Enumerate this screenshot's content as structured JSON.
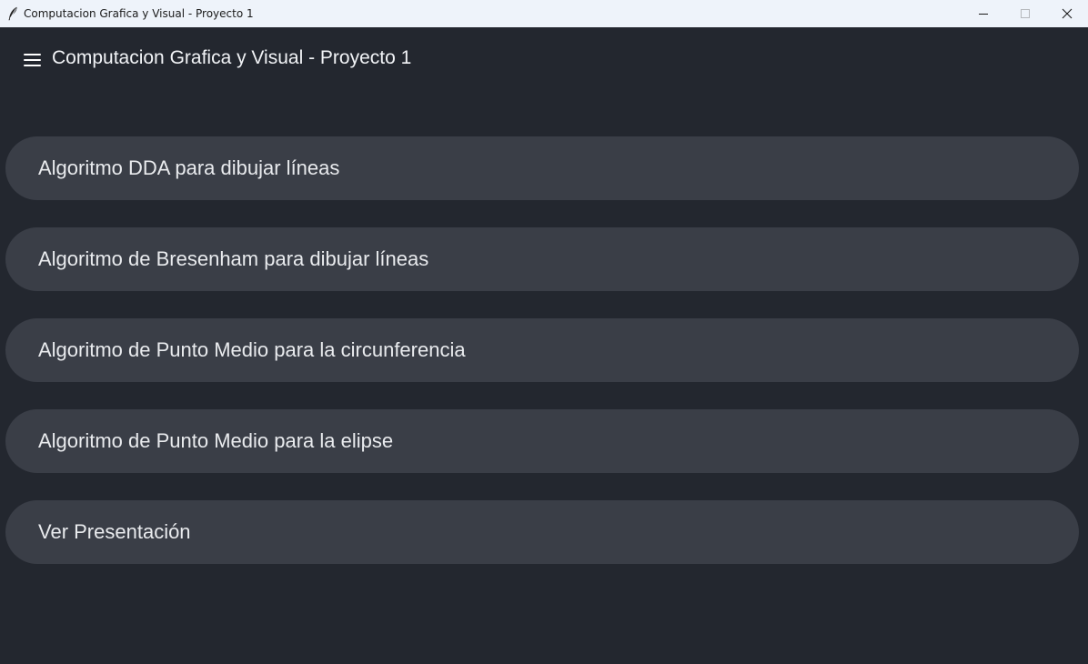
{
  "window": {
    "title": "Computacion Grafica y Visual - Proyecto 1",
    "icon": "feather-icon",
    "controls": [
      "minimize-icon",
      "maximize-icon",
      "close-icon"
    ]
  },
  "appbar": {
    "menu_icon": "hamburger-menu-icon",
    "title": "Computacion Grafica y Visual - Proyecto 1"
  },
  "menu": {
    "items": [
      {
        "label": "Algoritmo DDA para dibujar líneas"
      },
      {
        "label": "Algoritmo de Bresenham para dibujar líneas"
      },
      {
        "label": "Algoritmo de Punto Medio para la circunferencia"
      },
      {
        "label": "Algoritmo de Punto Medio para la elipse"
      },
      {
        "label": "Ver Presentación"
      }
    ]
  },
  "colors": {
    "background": "#23272f",
    "item_background": "#3a3e47",
    "text": "#e9ebee",
    "titlebar": "#eef3fa"
  }
}
